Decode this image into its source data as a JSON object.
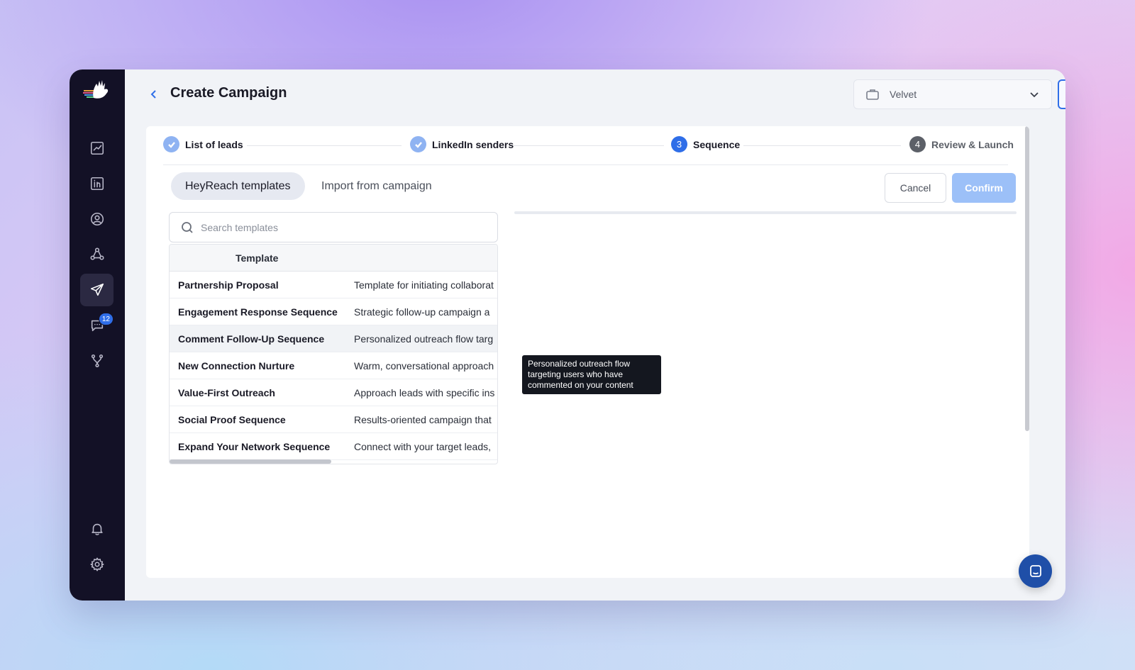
{
  "app": {
    "title": "Create Campaign"
  },
  "header": {
    "workspace_name": "Velvet"
  },
  "sidebar": {
    "items": [
      {
        "icon": "analytics-icon"
      },
      {
        "icon": "linkedin-icon"
      },
      {
        "icon": "user-icon"
      },
      {
        "icon": "network-icon"
      },
      {
        "icon": "send-icon",
        "active": true
      },
      {
        "icon": "chat-icon",
        "badge": "12"
      },
      {
        "icon": "integrations-icon"
      }
    ],
    "bottom": [
      {
        "icon": "bell-icon"
      },
      {
        "icon": "gear-icon"
      }
    ]
  },
  "stepper": {
    "steps": [
      {
        "label": "List of leads",
        "state": "done"
      },
      {
        "label": "LinkedIn senders",
        "state": "done"
      },
      {
        "label": "Sequence",
        "number": "3",
        "state": "current"
      },
      {
        "label": "Review & Launch",
        "number": "4",
        "state": "pending"
      }
    ]
  },
  "tabs": [
    {
      "label": "HeyReach templates",
      "active": true
    },
    {
      "label": "Import from campaign",
      "active": false
    }
  ],
  "actions": {
    "cancel": "Cancel",
    "confirm": "Confirm"
  },
  "search": {
    "placeholder": "Search templates"
  },
  "table": {
    "header": "Template",
    "rows": [
      {
        "name": "Partnership Proposal",
        "desc": "Template for initiating collaborat"
      },
      {
        "name": "Engagement Response Sequence",
        "desc": "Strategic follow-up campaign a"
      },
      {
        "name": "Comment Follow-Up Sequence",
        "desc": "Personalized outreach flow targ"
      },
      {
        "name": "New Connection Nurture",
        "desc": "Warm, conversational approach"
      },
      {
        "name": "Value-First Outreach",
        "desc": "Approach leads with specific ins"
      },
      {
        "name": "Social Proof Sequence",
        "desc": "Results-oriented campaign that"
      },
      {
        "name": "Expand Your Network Sequence",
        "desc": "Connect with your target leads,"
      }
    ]
  },
  "tooltip": {
    "text": "Personalized outreach flow targeting users who have commented on your content"
  },
  "colors": {
    "accent": "#2f6ee8",
    "sidebar": "#131126",
    "confirm_disabled": "#9cc0f8"
  }
}
